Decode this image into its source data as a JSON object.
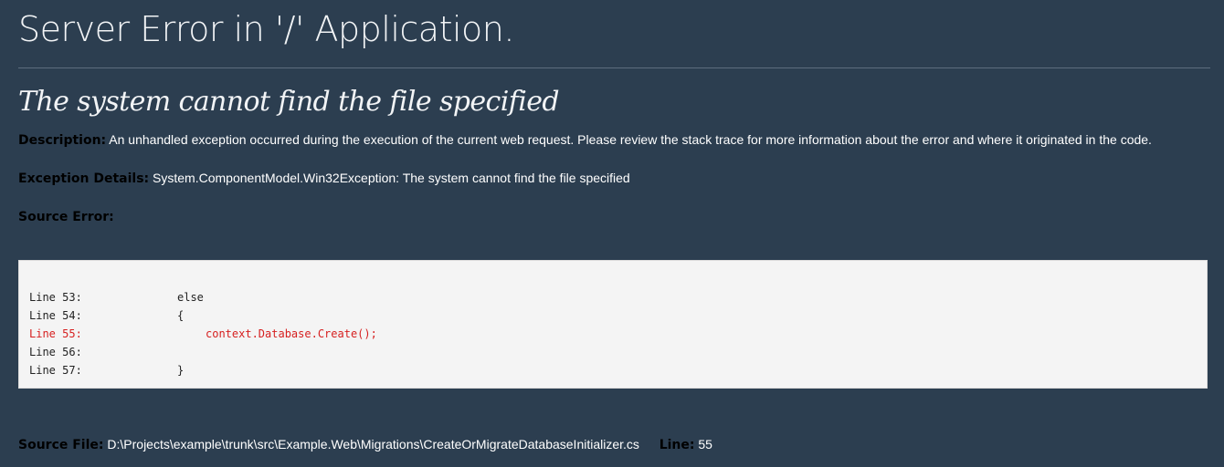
{
  "page_title": "Server Error in '/' Application.",
  "error_heading": "The system cannot find the file specified",
  "description": {
    "label": "Description:",
    "text": "An unhandled exception occurred during the execution of the current web request. Please review the stack trace for more information about the error and where it originated in the code."
  },
  "exception_details": {
    "label": "Exception Details:",
    "text": "System.ComponentModel.Win32Exception: The system cannot find the file specified"
  },
  "source_error": {
    "label": "Source Error:",
    "lines": [
      {
        "number": "Line 53:",
        "code": "else",
        "highlight": false
      },
      {
        "number": "Line 54:",
        "code": "{",
        "highlight": false
      },
      {
        "number": "Line 55:",
        "code": "context.Database.Create();",
        "highlight": true
      },
      {
        "number": "Line 56:",
        "code": "",
        "highlight": false
      },
      {
        "number": "Line 57:",
        "code": "}",
        "highlight": false
      }
    ]
  },
  "source_file": {
    "label": "Source File:",
    "path": "D:\\Projects\\example\\trunk\\src\\Example.Web\\Migrations\\CreateOrMigrateDatabaseInitializer.cs",
    "line_label": "Line:",
    "line_value": "55"
  },
  "colors": {
    "background": "#2c3e50",
    "code_background": "#f4f4f4",
    "error_line": "#d61f1f"
  }
}
